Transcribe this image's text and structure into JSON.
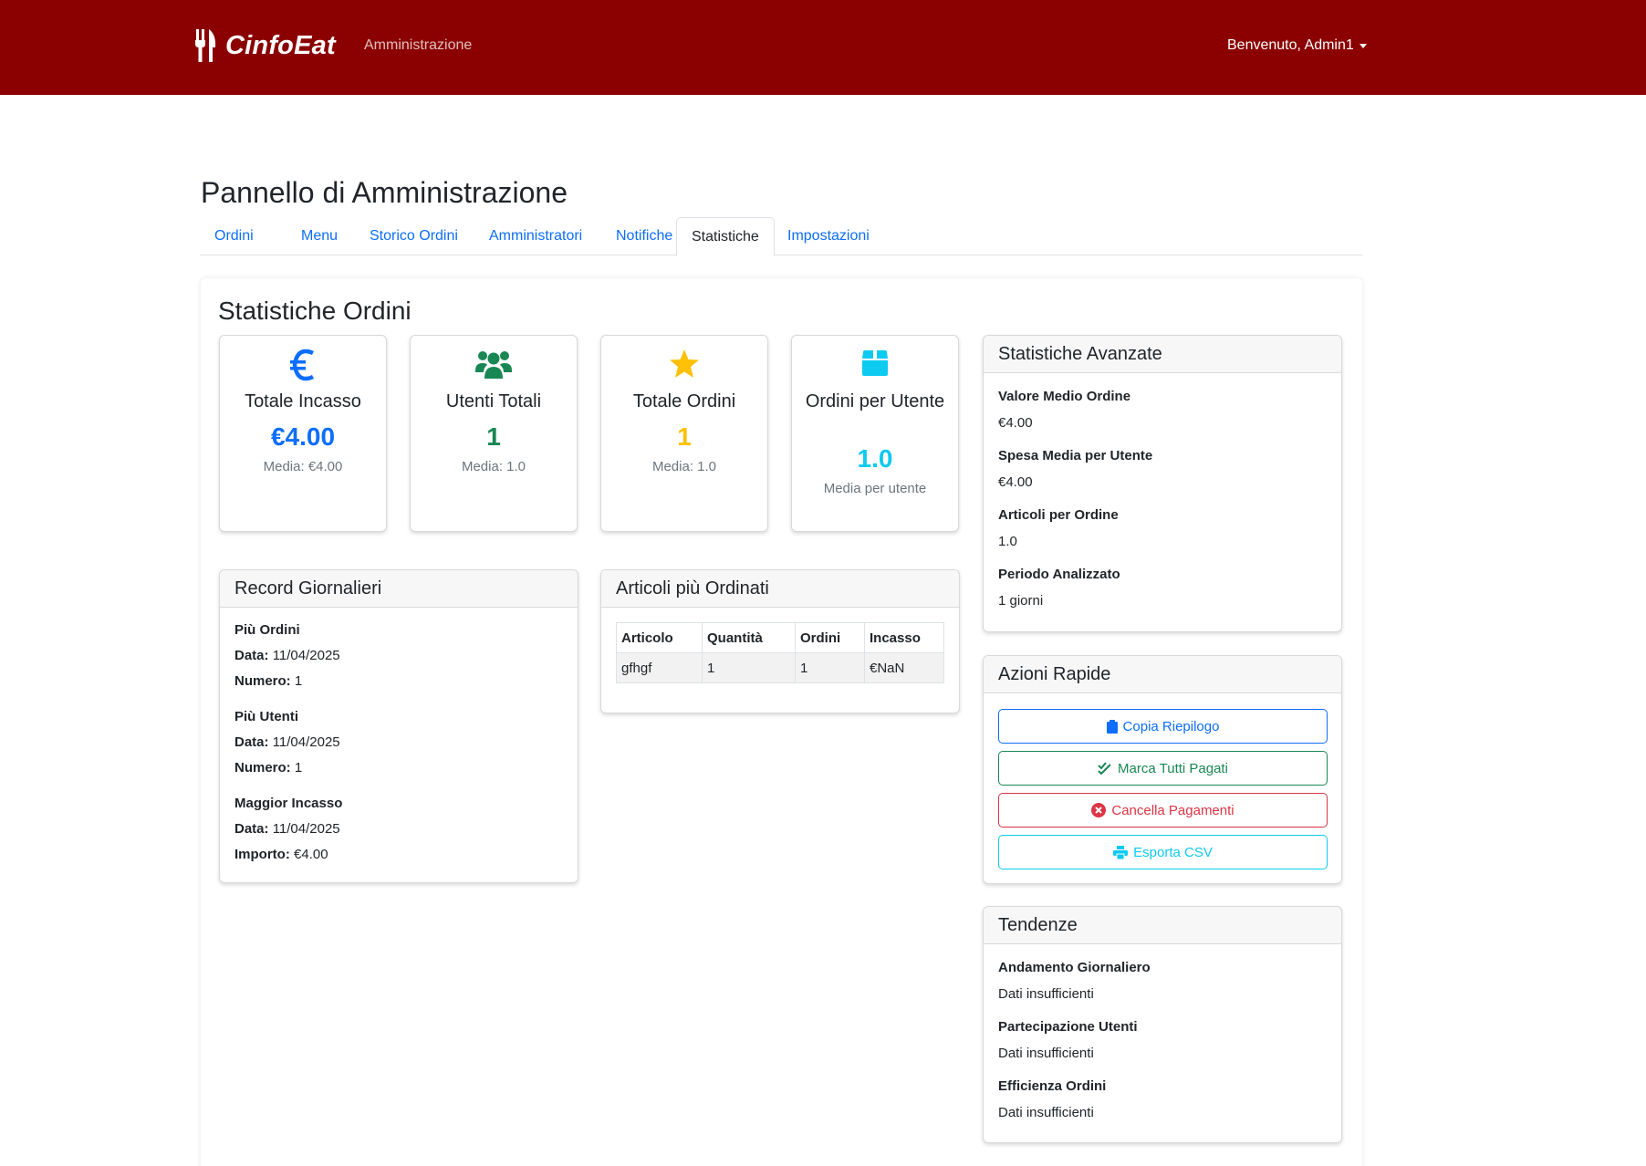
{
  "navbar": {
    "brand": "CinfoEat",
    "admin_link": "Amministrazione",
    "user_menu": "Benvenuto, Admin1"
  },
  "page_title": "Pannello di Amministrazione",
  "tabs": [
    {
      "label": "Ordini"
    },
    {
      "label": "Menu"
    },
    {
      "label": "Storico Ordini"
    },
    {
      "label": "Amministratori"
    },
    {
      "label": "Notifiche"
    },
    {
      "label": "Statistiche"
    },
    {
      "label": "Impostazioni"
    }
  ],
  "active_tab": "Statistiche",
  "section_title": "Statistiche Ordini",
  "stats": [
    {
      "icon": "euro-icon",
      "label": "Totale Incasso",
      "value": "€4.00",
      "sub": "Media: €4.00",
      "color": "#0d6efd"
    },
    {
      "icon": "users-icon",
      "label": "Utenti Totali",
      "value": "1",
      "sub": "Media: 1.0",
      "color": "#198754"
    },
    {
      "icon": "star-icon",
      "label": "Totale Ordini",
      "value": "1",
      "sub": "Media: 1.0",
      "color": "#ffc107"
    },
    {
      "icon": "box-icon",
      "label": "Ordini per Utente",
      "value": "1.0",
      "sub": "Media per utente",
      "color": "#0dcaf0"
    }
  ],
  "advanced": {
    "title": "Statistiche Avanzate",
    "items": [
      {
        "label": "Valore Medio Ordine",
        "value": "€4.00"
      },
      {
        "label": "Spesa Media per Utente",
        "value": "€4.00"
      },
      {
        "label": "Articoli per Ordine",
        "value": "1.0"
      },
      {
        "label": "Periodo Analizzato",
        "value": "1 giorni"
      }
    ]
  },
  "records": {
    "title": "Record Giornalieri",
    "groups": [
      {
        "title": "Più Ordini",
        "date_label": "Data:",
        "date": "11/04/2025",
        "num_label": "Numero:",
        "num": "1"
      },
      {
        "title": "Più Utenti",
        "date_label": "Data:",
        "date": "11/04/2025",
        "num_label": "Numero:",
        "num": "1"
      },
      {
        "title": "Maggior Incasso",
        "date_label": "Data:",
        "date": "11/04/2025",
        "num_label": "Importo:",
        "num": "€4.00"
      }
    ]
  },
  "top_items": {
    "title": "Articoli più Ordinati",
    "columns": [
      "Articolo",
      "Quantità",
      "Ordini",
      "Incasso"
    ],
    "rows": [
      [
        "gfhgf",
        "1",
        "1",
        "€NaN"
      ]
    ]
  },
  "quick_actions": {
    "title": "Azioni Rapide",
    "buttons": [
      {
        "label": "Copia Riepilogo",
        "icon": "clipboard-icon"
      },
      {
        "label": "Marca Tutti Pagati",
        "icon": "double-check-icon"
      },
      {
        "label": "Cancella Pagamenti",
        "icon": "x-circle-icon"
      },
      {
        "label": "Esporta CSV",
        "icon": "printer-icon"
      }
    ]
  },
  "trends": {
    "title": "Tendenze",
    "items": [
      {
        "label": "Andamento Giornaliero",
        "value": "Dati insufficienti"
      },
      {
        "label": "Partecipazione Utenti",
        "value": "Dati insufficienti"
      },
      {
        "label": "Efficienza Ordini",
        "value": "Dati insufficienti"
      }
    ]
  }
}
